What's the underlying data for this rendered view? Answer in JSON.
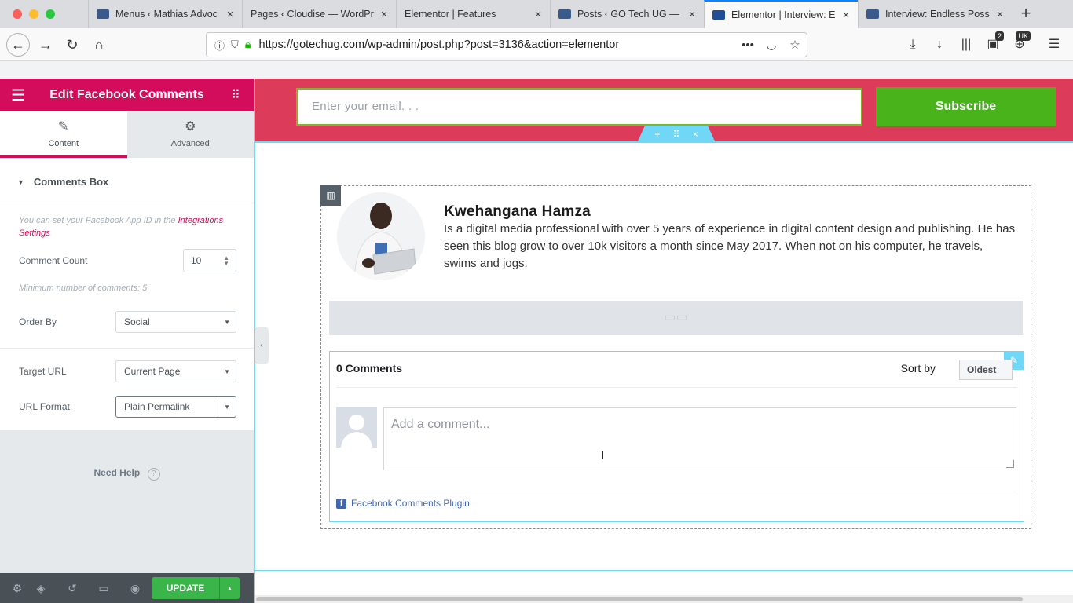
{
  "browser": {
    "tabs": [
      {
        "title": "Menus ‹ Mathias Advoc",
        "favicon_color": "#3a5a8c"
      },
      {
        "title": "Pages ‹ Cloudise — WordPr",
        "favicon_color": "#21759b"
      },
      {
        "title": "Elementor | Features",
        "favicon_color": "#d30c5c"
      },
      {
        "title": "Posts ‹ GO Tech UG —",
        "favicon_color": "#3a5a8c"
      },
      {
        "title": "Elementor | Interview: E",
        "favicon_color": "#1f4e96",
        "active": true
      },
      {
        "title": "Interview: Endless Poss",
        "favicon_color": "#3a5a8c"
      }
    ],
    "url": "https://gotechug.com/wp-admin/post.php?post=3136&action=elementor",
    "library_badge": "2",
    "uk_badge": "UK"
  },
  "panel": {
    "title": "Edit Facebook Comments",
    "tabs": {
      "content": "Content",
      "advanced": "Advanced"
    },
    "section": "Comments Box",
    "app_id_note": "You can set your Facebook App ID in the",
    "app_id_link": "Integrations Settings",
    "comment_count_label": "Comment Count",
    "comment_count_value": "10",
    "min_note": "Minimum number of comments: 5",
    "order_by_label": "Order By",
    "order_by_value": "Social",
    "target_url_label": "Target URL",
    "target_url_value": "Current Page",
    "url_format_label": "URL Format",
    "url_format_value": "Plain Permalink",
    "need_help": "Need Help",
    "update": "UPDATE"
  },
  "preview": {
    "email_placeholder": "Enter your email. . .",
    "subscribe": "Subscribe",
    "author_name": "Kwehangana Hamza",
    "author_bio": "Is a digital media professional with over 5 years of experience in digital content design and publishing. He has seen this blog grow to over 10k visitors a month since May 2017. When not on his computer, he travels, swims and jogs.",
    "fb": {
      "count": "0 Comments",
      "sort_label": "Sort by",
      "sort_value": "Oldest",
      "placeholder": "Add a comment...",
      "plugin_label": "Facebook Comments Plugin"
    }
  },
  "colors": {
    "elementor_pink": "#d30c5c",
    "band_red": "#dc3c5a",
    "subscribe_green": "#48b31b",
    "update_green": "#39b54a",
    "outline_blue": "#71d7f7"
  }
}
